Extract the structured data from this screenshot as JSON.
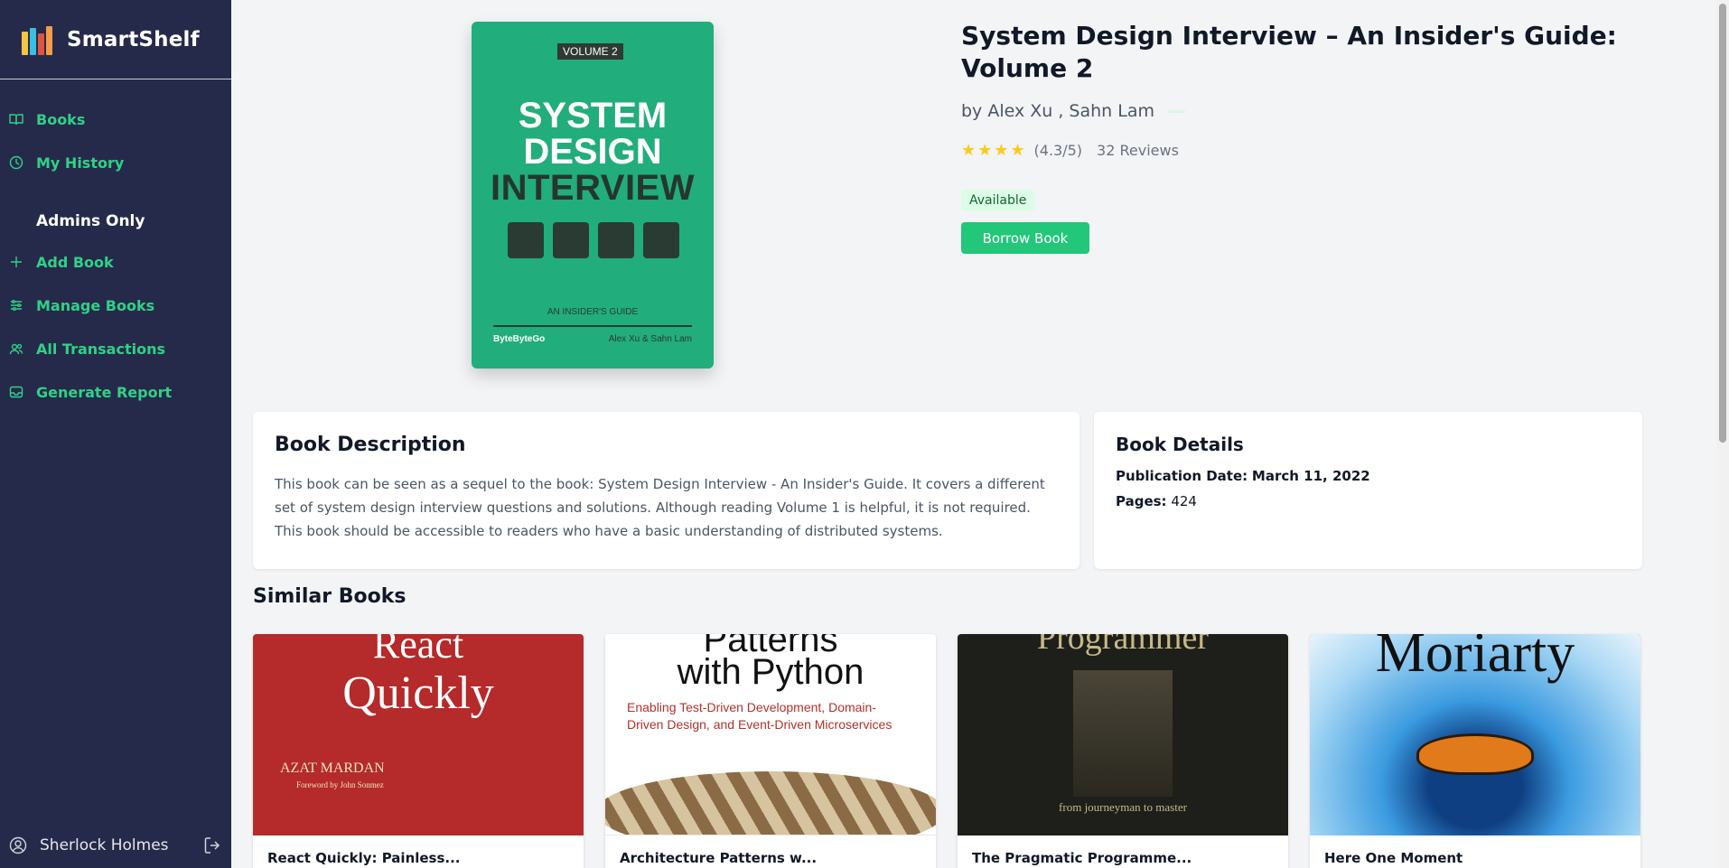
{
  "app": {
    "name": "SmartShelf"
  },
  "sidebar": {
    "items": [
      {
        "label": "Books",
        "icon": "book-open-icon"
      },
      {
        "label": "My History",
        "icon": "clock-icon"
      }
    ],
    "admins_heading": "Admins Only",
    "admin_items": [
      {
        "label": "Add Book",
        "icon": "plus-icon"
      },
      {
        "label": "Manage Books",
        "icon": "sliders-icon"
      },
      {
        "label": "All Transactions",
        "icon": "users-icon"
      },
      {
        "label": "Generate Report",
        "icon": "inbox-icon"
      }
    ],
    "user_name": "Sherlock Holmes"
  },
  "book": {
    "title": "System Design Interview – An Insider's Guide: Volume 2",
    "authors": "by Alex Xu , Sahn Lam",
    "rating_text": "(4.3/5)",
    "rating_value": 4.3,
    "reviews": "32 Reviews",
    "status": "Available",
    "borrow_label": "Borrow Book",
    "cover": {
      "volume": "VOLUME 2",
      "line1": "SYSTEM",
      "line2": "DESIGN",
      "line3": "INTERVIEW",
      "guide": "AN INSIDER'S GUIDE",
      "publisher": "ByteByteGo",
      "authors": "Alex Xu & Sahn Lam",
      "color": "#21ad7c"
    }
  },
  "description": {
    "heading": "Book Description",
    "text": "This book can be seen as a sequel to the book: System Design Interview - An Insider's Guide. It covers a different set of system design interview questions and solutions. Although reading Volume 1 is helpful, it is not required. This book should be accessible to readers who have a basic understanding of distributed systems."
  },
  "details": {
    "heading": "Book Details",
    "pub_label": "Publication Date:",
    "pub_value": "March 11, 2022",
    "pages_label": "Pages:",
    "pages_value": "424"
  },
  "similar": {
    "heading": "Similar Books",
    "books": [
      {
        "title": "React Quickly: Painless...",
        "cover_text": [
          "React",
          "Quickly",
          "AZAT MARDAN",
          "Foreword by John Sonmez"
        ]
      },
      {
        "title": "Architecture Patterns w...",
        "cover_text": [
          "Patterns",
          "with Python",
          "Enabling Test-Driven Development, Domain-Driven Design, and Event-Driven Microservices"
        ]
      },
      {
        "title": "The Pragmatic Programme...",
        "cover_text": [
          "Programmer",
          "from journeyman to master"
        ]
      },
      {
        "title": "Here One Moment",
        "cover_text": [
          "Moriarty"
        ]
      }
    ]
  },
  "colors": {
    "sidebar": "#262a4a",
    "accent": "#22c77a",
    "nav_text": "#2fd186"
  }
}
